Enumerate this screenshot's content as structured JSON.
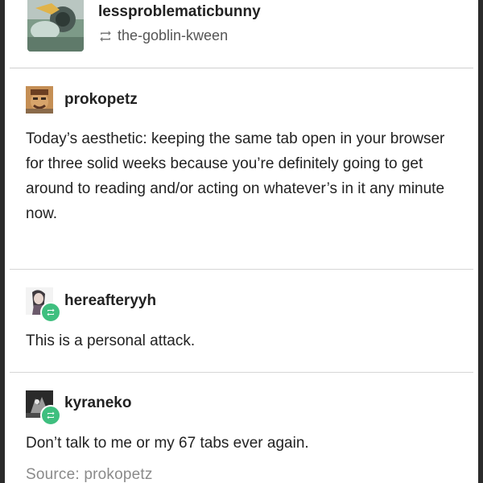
{
  "header": {
    "reblogger": "lessproblematicbunny",
    "reblogged_from": "the-goblin-kween",
    "avatar_icon": "avatar-image",
    "reblog_icon": "reblog-icon"
  },
  "posts": [
    {
      "username": "prokopetz",
      "avatar_icon": "avatar-image",
      "text": "Today’s aesthetic: keeping the same tab open in your browser for three solid weeks because you’re definitely going to get around to reading and/or acting on whatever’s in it any minute now."
    },
    {
      "username": "hereafteryyh",
      "avatar_icon": "avatar-image",
      "badge_icon": "reblog-badge-icon",
      "text": "This is a personal attack."
    },
    {
      "username": "kyraneko",
      "avatar_icon": "avatar-image",
      "badge_icon": "reblog-badge-icon",
      "text": "Don’t talk to me or my 67 tabs ever again."
    }
  ],
  "source": {
    "text": "Source: prokopetz"
  },
  "colors": {
    "badge_green": "#3fbf7f",
    "divider": "#d6d6d6",
    "source_grey": "#8a8a8a"
  }
}
